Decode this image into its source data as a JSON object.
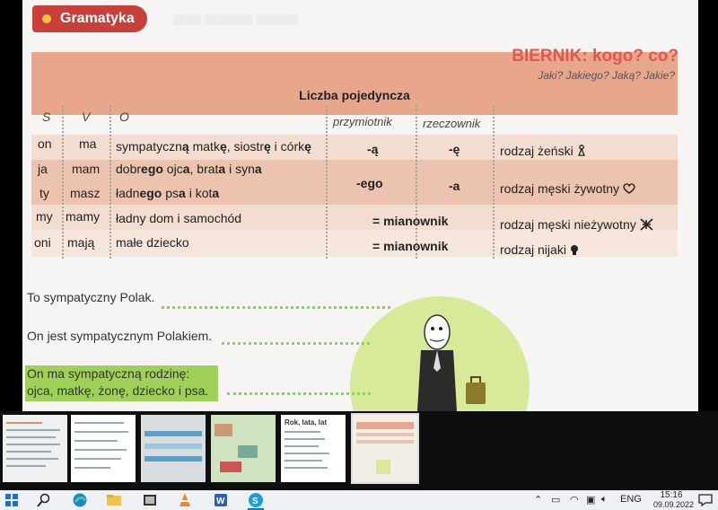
{
  "textbook": {
    "section_label": "Gramatyka",
    "title": "BIERNIK: kogo? co?",
    "questions": "Jaki? Jakiego? Jaką? Jakie?",
    "table_caption": "Liczba pojedyncza",
    "headers": {
      "s": "S",
      "v": "V",
      "o": "O",
      "adjective": "przymiotnik",
      "noun": "rzeczownik"
    },
    "rows": [
      {
        "s": "on",
        "v": "ma",
        "o_parts": [
          "sympatyczn",
          "ą",
          " matk",
          "ę",
          ", siostr",
          "ę",
          " i córk",
          "ę"
        ],
        "adj": "-ą",
        "noun": "-ę",
        "gender": "rodzaj żeński"
      },
      {
        "s": "ja",
        "v": "mam",
        "o_parts": [
          "dobr",
          "ego",
          " ojc",
          "a",
          ", brat",
          "a",
          " i syn",
          "a"
        ]
      },
      {
        "s": "ty",
        "v": "masz",
        "o_parts": [
          "ładn",
          "ego",
          " ps",
          "a",
          " i kot",
          "a"
        ],
        "adj": "-ego",
        "noun": "-a",
        "gender": "rodzaj męski żywotny"
      },
      {
        "s": "my",
        "v": "mamy",
        "o": "ładny dom i samochód",
        "adj_noun": "= mianownik",
        "gender": "rodzaj męski nieżywotny"
      },
      {
        "s": "oni",
        "v": "mają",
        "o": "małe dziecko",
        "adj_noun": "= mianownik",
        "gender": "rodzaj nijaki"
      }
    ],
    "examples": [
      "To sympatyczny Polak.",
      "On jest sympatycznym Polakiem.",
      "On ma sympatyczną rodzinę:",
      "ojca, matkę, żonę, dziecko i psa."
    ]
  },
  "thumbnails": [
    {
      "title": ""
    },
    {
      "title": ""
    },
    {
      "title": ""
    },
    {
      "title": ""
    },
    {
      "title": "Rok, lata, lat"
    },
    {
      "title": ""
    }
  ],
  "taskbar": {
    "language": "ENG",
    "time": "15:16",
    "date": "09.09.2022"
  },
  "colors": {
    "pill": "#c8403a",
    "title": "#e0584d",
    "header_band": "#e8a78c",
    "highlight": "#9fd158",
    "circle": "#d7ea9a"
  }
}
